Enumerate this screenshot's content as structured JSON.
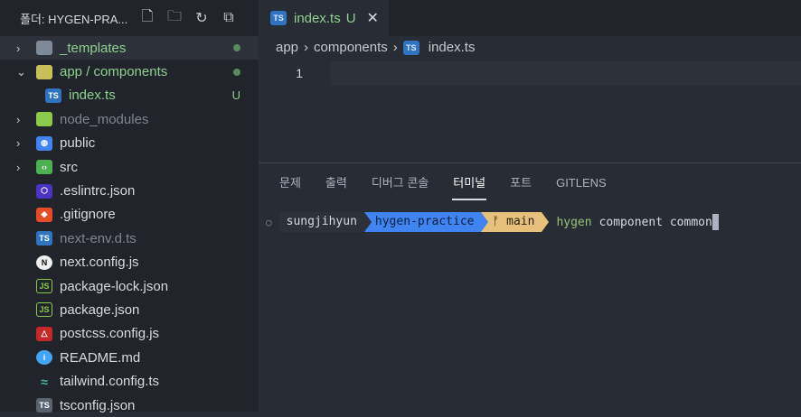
{
  "explorer": {
    "title": "폴더: HYGEN-PRA...",
    "actions": [
      "new-file-icon",
      "new-folder-icon",
      "refresh-icon",
      "collapse-icon"
    ],
    "items": [
      {
        "label": "_templates",
        "type": "folder",
        "expanded": false,
        "status": "dot",
        "color": "green",
        "icon": "folder-icon"
      },
      {
        "label": "app / components",
        "type": "folder",
        "expanded": true,
        "status": "dot",
        "color": "green",
        "icon": "folder-open-icon"
      },
      {
        "label": "index.ts",
        "type": "file",
        "status": "U",
        "color": "green",
        "icon": "typescript-icon",
        "indent": true
      },
      {
        "label": "node_modules",
        "type": "folder",
        "expanded": false,
        "color": "dim",
        "icon": "node-folder-icon"
      },
      {
        "label": "public",
        "type": "folder",
        "expanded": false,
        "icon": "public-folder-icon"
      },
      {
        "label": "src",
        "type": "folder",
        "expanded": false,
        "icon": "src-folder-icon"
      },
      {
        "label": ".eslintrc.json",
        "type": "file",
        "icon": "eslint-icon"
      },
      {
        "label": ".gitignore",
        "type": "file",
        "icon": "git-icon"
      },
      {
        "label": "next-env.d.ts",
        "type": "file",
        "color": "dim",
        "icon": "typescript-icon"
      },
      {
        "label": "next.config.js",
        "type": "file",
        "icon": "next-icon"
      },
      {
        "label": "package-lock.json",
        "type": "file",
        "icon": "nodejs-icon"
      },
      {
        "label": "package.json",
        "type": "file",
        "icon": "nodejs-icon"
      },
      {
        "label": "postcss.config.js",
        "type": "file",
        "icon": "postcss-icon"
      },
      {
        "label": "README.md",
        "type": "file",
        "icon": "info-icon"
      },
      {
        "label": "tailwind.config.ts",
        "type": "file",
        "icon": "tailwind-icon"
      },
      {
        "label": "tsconfig.json",
        "type": "file",
        "icon": "tsconfig-icon"
      }
    ]
  },
  "editor": {
    "tab": {
      "label": "index.ts",
      "status": "U"
    },
    "breadcrumb": [
      "app",
      "components",
      "index.ts"
    ],
    "line_numbers": [
      "1"
    ]
  },
  "panel": {
    "tabs": [
      "문제",
      "출력",
      "디버그 콘솔",
      "터미널",
      "포트",
      "GITLENS"
    ],
    "active_tab": "터미널",
    "terminal": {
      "user": "sungjihyun",
      "dir": "hygen-practice",
      "branch": "main",
      "command": "hygen",
      "args": "component common"
    }
  },
  "colors": {
    "accent_green": "#8fcf8f",
    "dir_segment": "#3f84f0",
    "branch_segment": "#e7c07b"
  }
}
